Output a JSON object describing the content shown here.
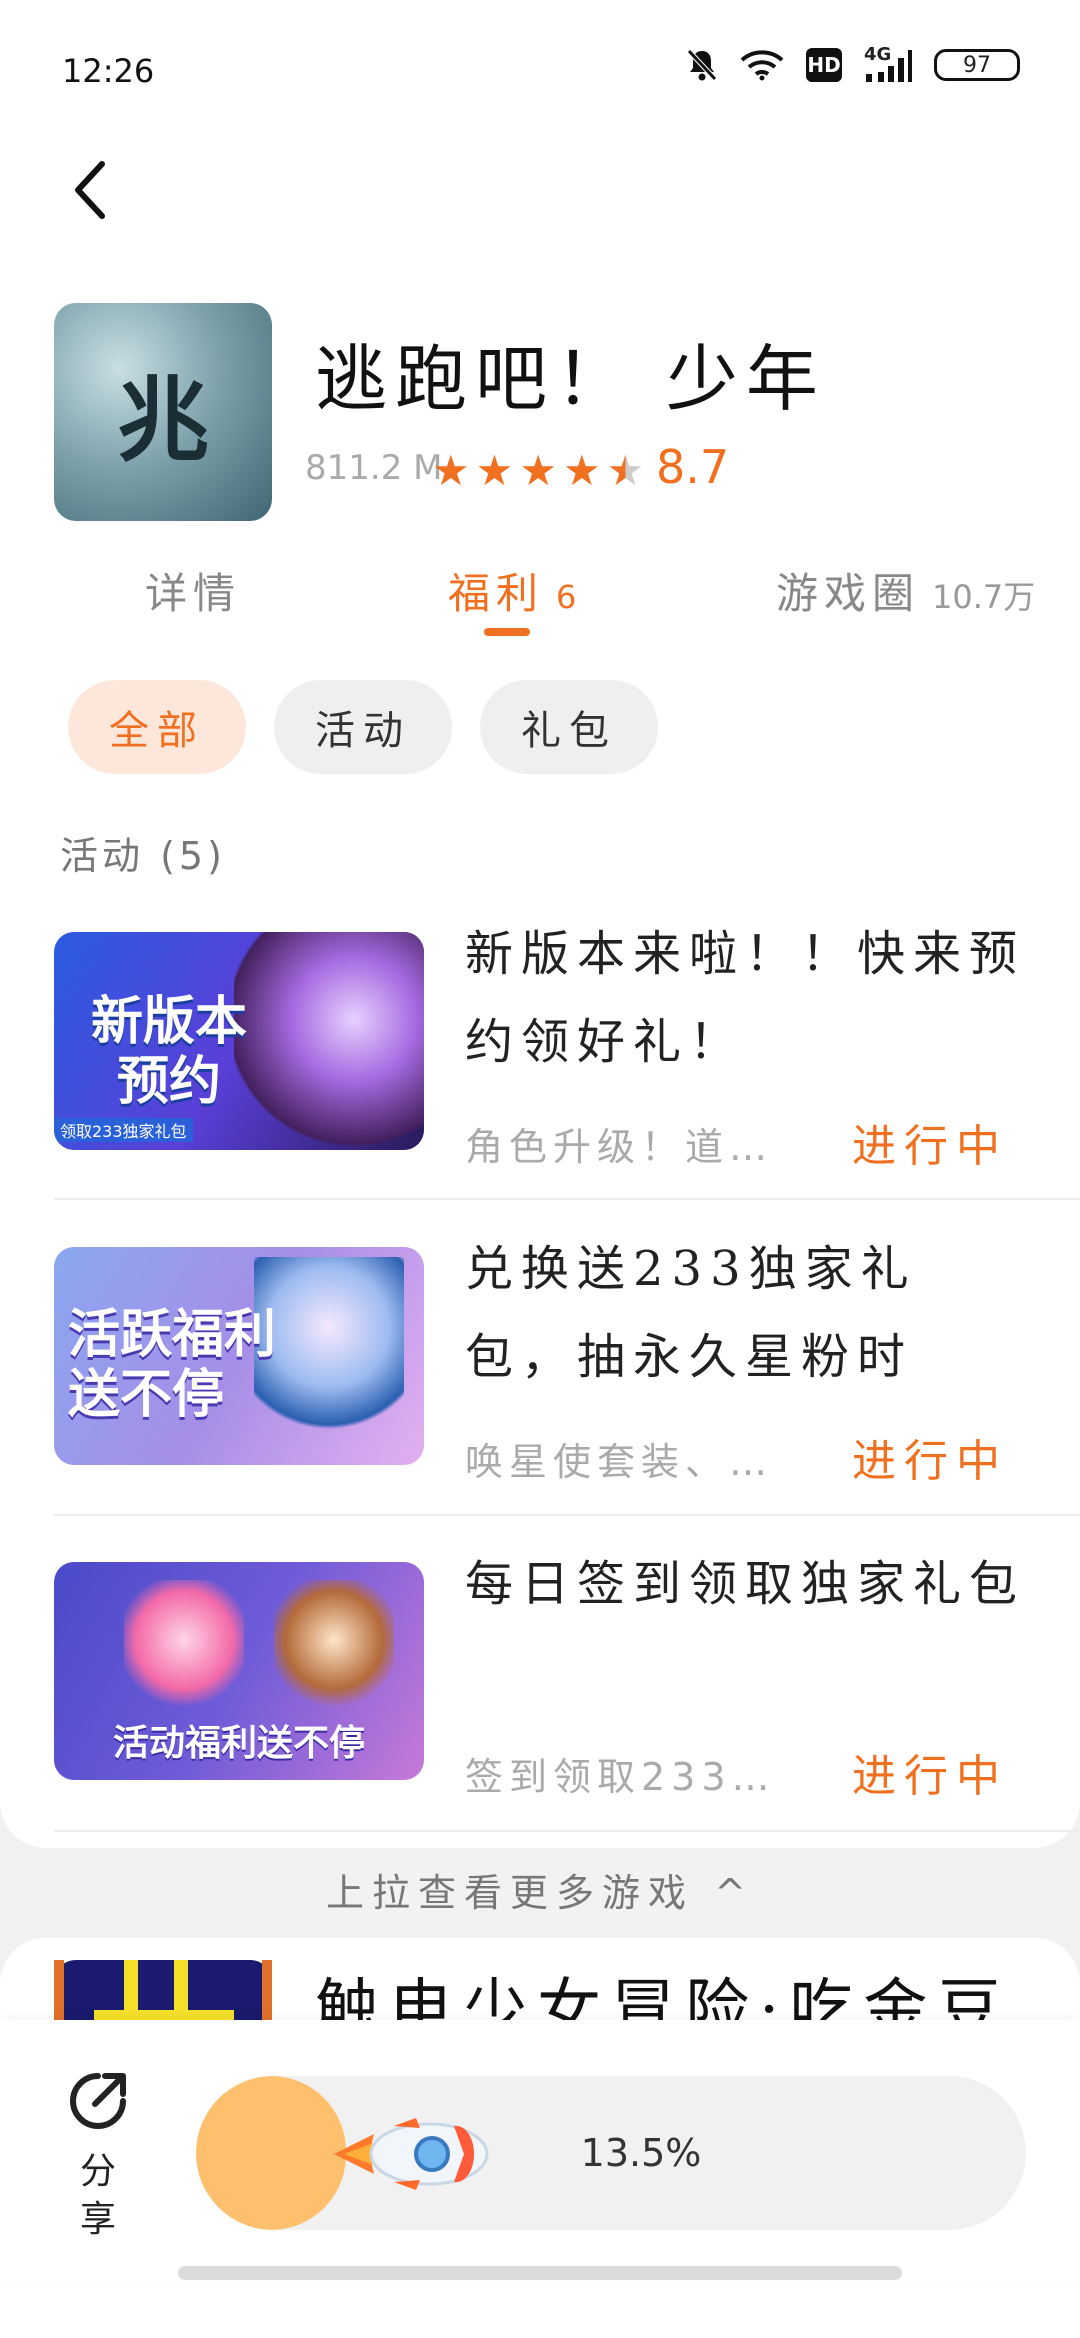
{
  "status_bar": {
    "time": "12:26",
    "battery": "97",
    "network": "4G",
    "hd": "HD"
  },
  "app": {
    "icon_glyph": "兆",
    "title": "逃跑吧！ 少年",
    "size": "811.2 M",
    "rating": "8.7",
    "stars": 4.5
  },
  "tabs": [
    {
      "label": "详情",
      "count": ""
    },
    {
      "label": "福利",
      "count": "6"
    },
    {
      "label": "游戏圈",
      "count": "10.7万"
    }
  ],
  "filters": [
    "全部",
    "活动",
    "礼包"
  ],
  "section": {
    "title": "活动 (5)"
  },
  "activities": [
    {
      "thumb_text": "新版本\n预约",
      "thumb_sub": "领取233独家礼包",
      "title": "新版本来啦！！快来预约领好礼！",
      "desc": "角色升级！道…",
      "status": "进行中"
    },
    {
      "thumb_text": "活跃福利\n送不停",
      "thumb_sub": "",
      "title": "兑换送233独家礼包，抽永久星粉时",
      "desc": "唤星使套装、…",
      "status": "进行中"
    },
    {
      "thumb_text": "活动福利送不停",
      "thumb_sub": "",
      "title": "每日签到领取独家礼包",
      "desc": "签到领取233…",
      "status": "进行中"
    }
  ],
  "pull_more": "上拉查看更多游戏 ^",
  "next_game": {
    "title": "触电少女冒险·吃金豆"
  },
  "bottom": {
    "share_label": "分享",
    "progress_text": "13.5%",
    "progress": 0.135
  },
  "colors": {
    "accent": "#f07020",
    "progress_fill": "#ffc06e"
  }
}
